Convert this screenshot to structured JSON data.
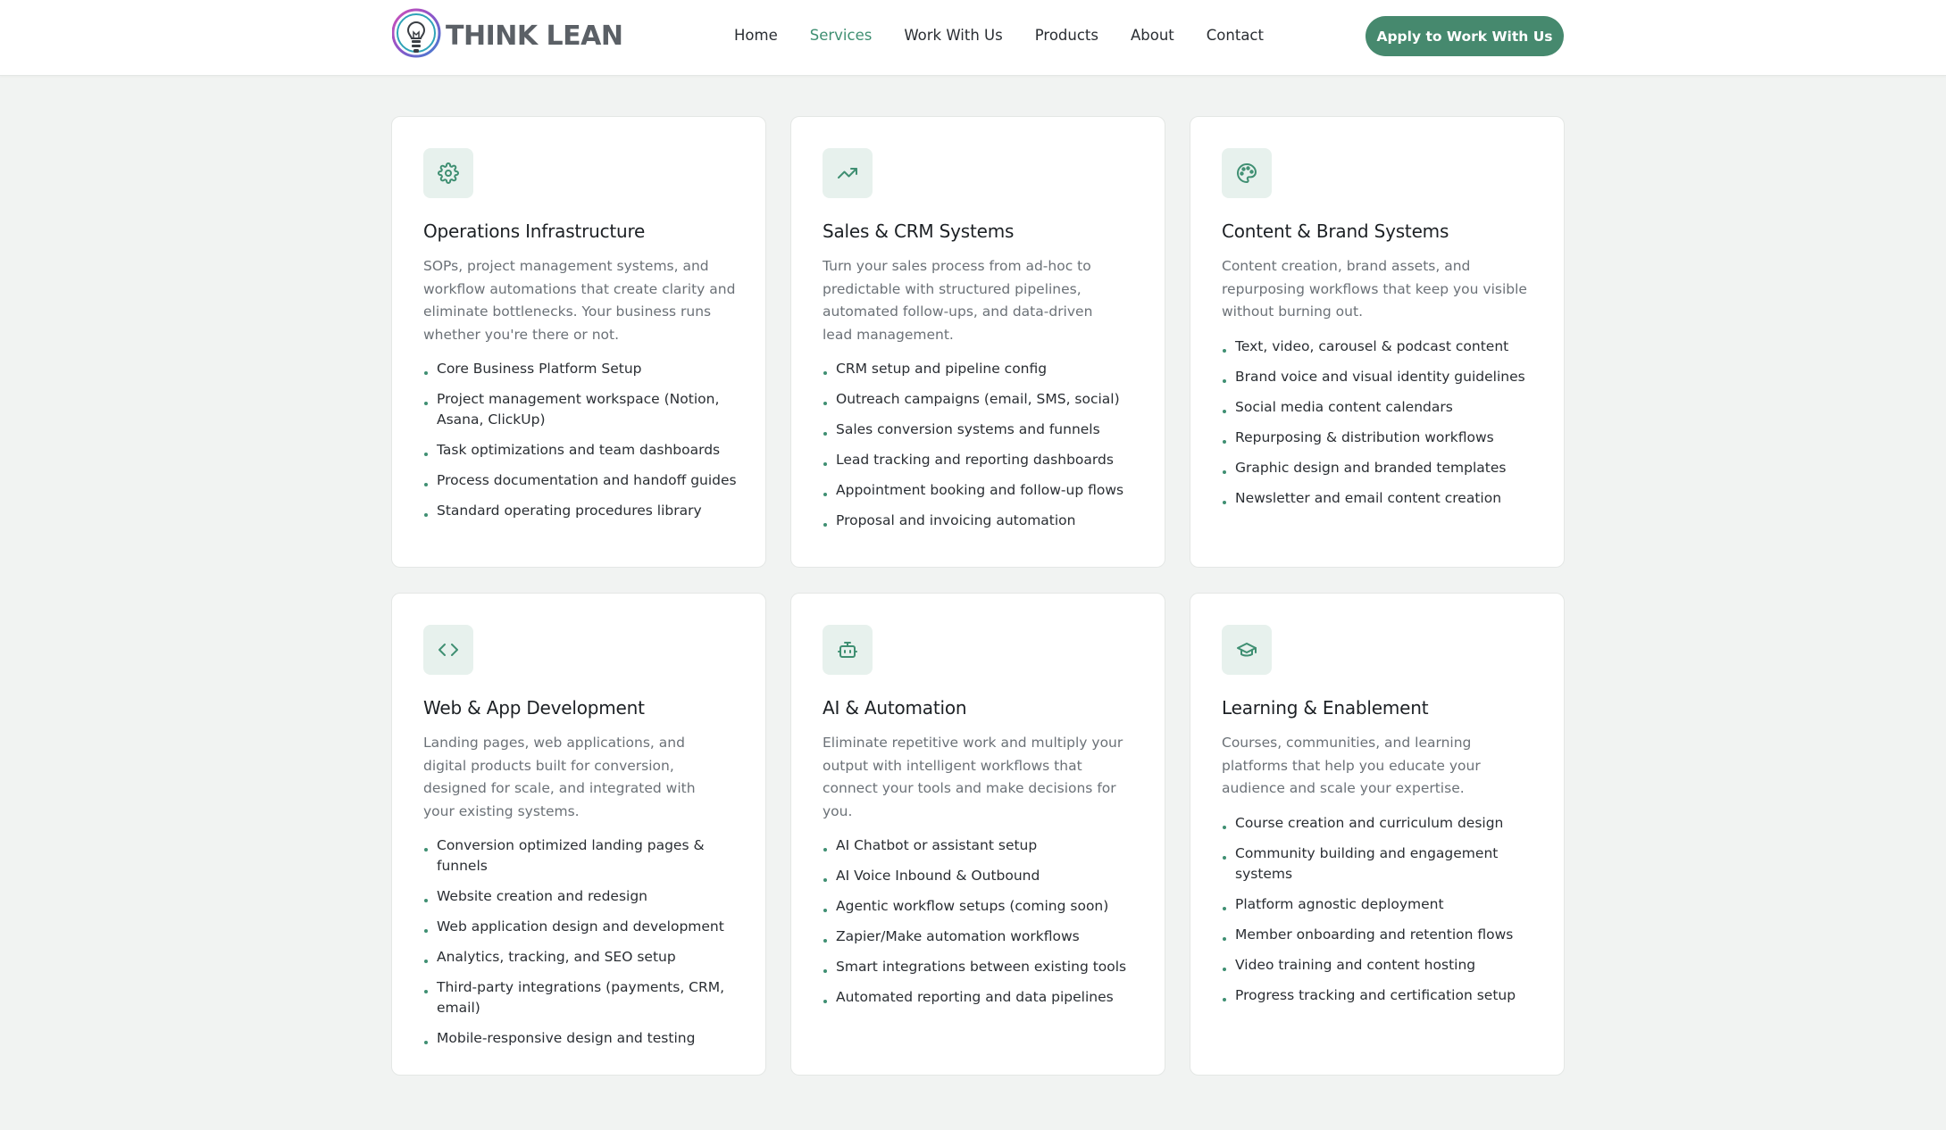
{
  "brand": {
    "name": "THINK LEAN",
    "logo_icon": "lightbulb-icon"
  },
  "nav": {
    "items": [
      {
        "label": "Home",
        "active": false
      },
      {
        "label": "Services",
        "active": true
      },
      {
        "label": "Work With Us",
        "active": false
      },
      {
        "label": "Products",
        "active": false
      },
      {
        "label": "About",
        "active": false
      },
      {
        "label": "Contact",
        "active": false
      }
    ],
    "cta_label": "Apply to Work With Us"
  },
  "colors": {
    "accent": "#46896e",
    "accent_light": "#e7f1ed",
    "background": "#f1f3f2"
  },
  "services": [
    {
      "icon": "gear-icon",
      "title": "Operations Infrastructure",
      "description": "SOPs, project management systems, and workflow automations that create clarity and eliminate bottlenecks. Your business runs whether you're there or not.",
      "features": [
        "Core Business Platform Setup",
        "Project management workspace (Notion, Asana, ClickUp)",
        "Task optimizations and team dashboards",
        "Process documentation and handoff guides",
        "Standard operating procedures library"
      ]
    },
    {
      "icon": "trending-up-icon",
      "title": "Sales & CRM Systems",
      "description": "Turn your sales process from ad-hoc to predictable with structured pipelines, automated follow-ups, and data-driven lead management.",
      "features": [
        "CRM setup and pipeline config",
        "Outreach campaigns (email, SMS, social)",
        "Sales conversion systems and funnels",
        "Lead tracking and reporting dashboards",
        "Appointment booking and follow-up flows",
        "Proposal and invoicing automation"
      ]
    },
    {
      "icon": "palette-icon",
      "title": "Content & Brand Systems",
      "description": "Content creation, brand assets, and repurposing workflows that keep you visible without burning out.",
      "features": [
        "Text, video, carousel & podcast content",
        "Brand voice and visual identity guidelines",
        "Social media content calendars",
        "Repurposing & distribution workflows",
        "Graphic design and branded templates",
        "Newsletter and email content creation"
      ]
    },
    {
      "icon": "code-icon",
      "title": "Web & App Development",
      "description": "Landing pages, web applications, and digital products built for conversion, designed for scale, and integrated with your existing systems.",
      "features": [
        "Conversion optimized landing pages & funnels",
        "Website creation and redesign",
        "Web application design and development",
        "Analytics, tracking, and SEO setup",
        "Third-party integrations (payments, CRM, email)",
        "Mobile-responsive design and testing"
      ]
    },
    {
      "icon": "robot-icon",
      "title": "AI & Automation",
      "description": "Eliminate repetitive work and multiply your output with intelligent workflows that connect your tools and make decisions for you.",
      "features": [
        "AI Chatbot or assistant setup",
        "AI Voice Inbound & Outbound",
        "Agentic workflow setups (coming soon)",
        "Zapier/Make automation workflows",
        "Smart integrations between existing tools",
        "Automated reporting and data pipelines"
      ]
    },
    {
      "icon": "graduation-cap-icon",
      "title": "Learning & Enablement",
      "description": "Courses, communities, and learning platforms that help you educate your audience and scale your expertise.",
      "features": [
        "Course creation and curriculum design",
        "Community building and engagement systems",
        "Platform agnostic deployment",
        "Member onboarding and retention flows",
        "Video training and content hosting",
        "Progress tracking and certification setup"
      ]
    }
  ]
}
